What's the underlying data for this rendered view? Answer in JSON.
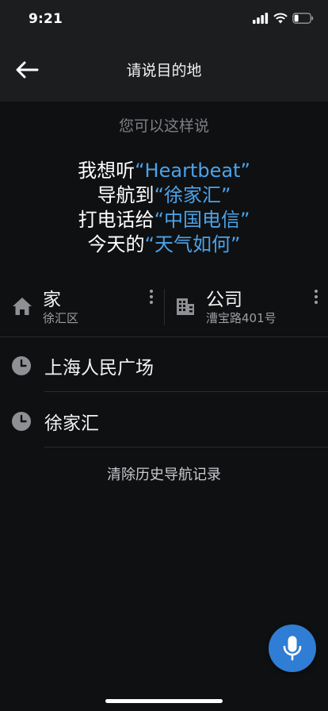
{
  "status": {
    "time": "9:21"
  },
  "nav": {
    "title": "请说目的地"
  },
  "hint": {
    "title": "您可以这样说"
  },
  "examples": [
    {
      "prefix": "我想听",
      "quote": "“Heartbeat”"
    },
    {
      "prefix": "导航到",
      "quote": "“徐家汇”"
    },
    {
      "prefix": "打电话给",
      "quote": "“中国电信”"
    },
    {
      "prefix": "今天的",
      "quote": "“天气如何”"
    }
  ],
  "shortcuts": {
    "home": {
      "label": "家",
      "sub": "徐汇区"
    },
    "work": {
      "label": "公司",
      "sub": "漕宝路401号"
    }
  },
  "history": [
    {
      "text": "上海人民广场"
    },
    {
      "text": "徐家汇"
    }
  ],
  "clear_history_label": "清除历史导航记录",
  "colors": {
    "accent": "#4aa3ea",
    "mic_button": "#2f7dd4",
    "background": "#0f1012",
    "bar": "#1c1d1f"
  }
}
